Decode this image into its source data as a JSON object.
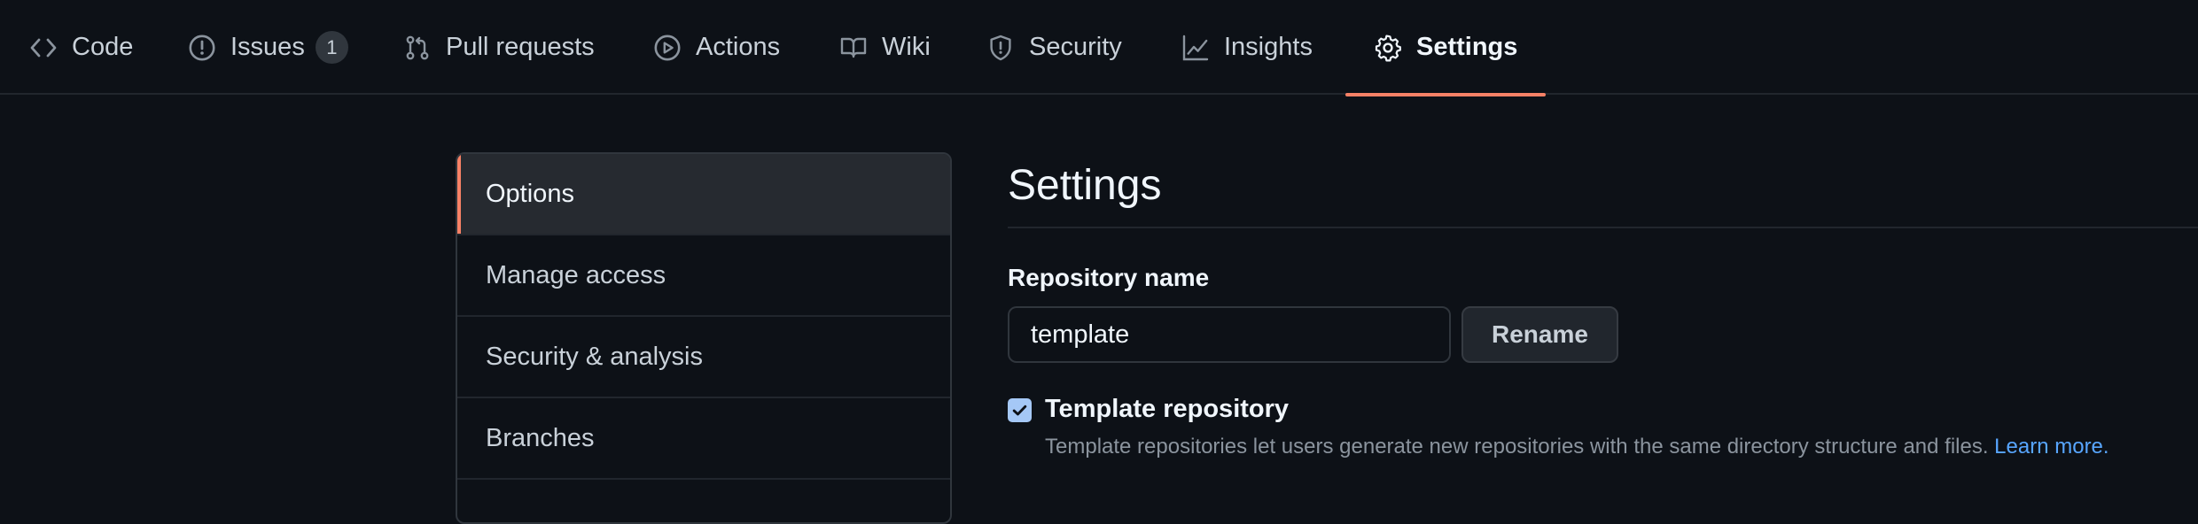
{
  "repo_nav": {
    "tabs": [
      {
        "label": "Code",
        "icon": "code-icon"
      },
      {
        "label": "Issues",
        "icon": "issue-opened-icon",
        "count": "1"
      },
      {
        "label": "Pull requests",
        "icon": "git-pull-request-icon"
      },
      {
        "label": "Actions",
        "icon": "play-icon"
      },
      {
        "label": "Wiki",
        "icon": "book-icon"
      },
      {
        "label": "Security",
        "icon": "shield-icon"
      },
      {
        "label": "Insights",
        "icon": "graph-icon"
      },
      {
        "label": "Settings",
        "icon": "gear-icon",
        "selected": true
      }
    ],
    "selected_underline_color": "#f78166"
  },
  "settings_menu": {
    "items": [
      {
        "label": "Options",
        "active": true
      },
      {
        "label": "Manage access"
      },
      {
        "label": "Security & analysis"
      },
      {
        "label": "Branches"
      }
    ]
  },
  "main": {
    "title": "Settings",
    "repo_name_label": "Repository name",
    "repo_name_value": "template",
    "rename_button": "Rename",
    "template_checkbox": {
      "checked": true,
      "label": "Template repository",
      "description": "Template repositories let users generate new repositories with the same directory structure and files.",
      "link": "Learn more."
    }
  },
  "colors": {
    "background": "#0d1117",
    "accent": "#f78166",
    "link": "#58a6ff",
    "checkbox": "#a5c8f6"
  }
}
